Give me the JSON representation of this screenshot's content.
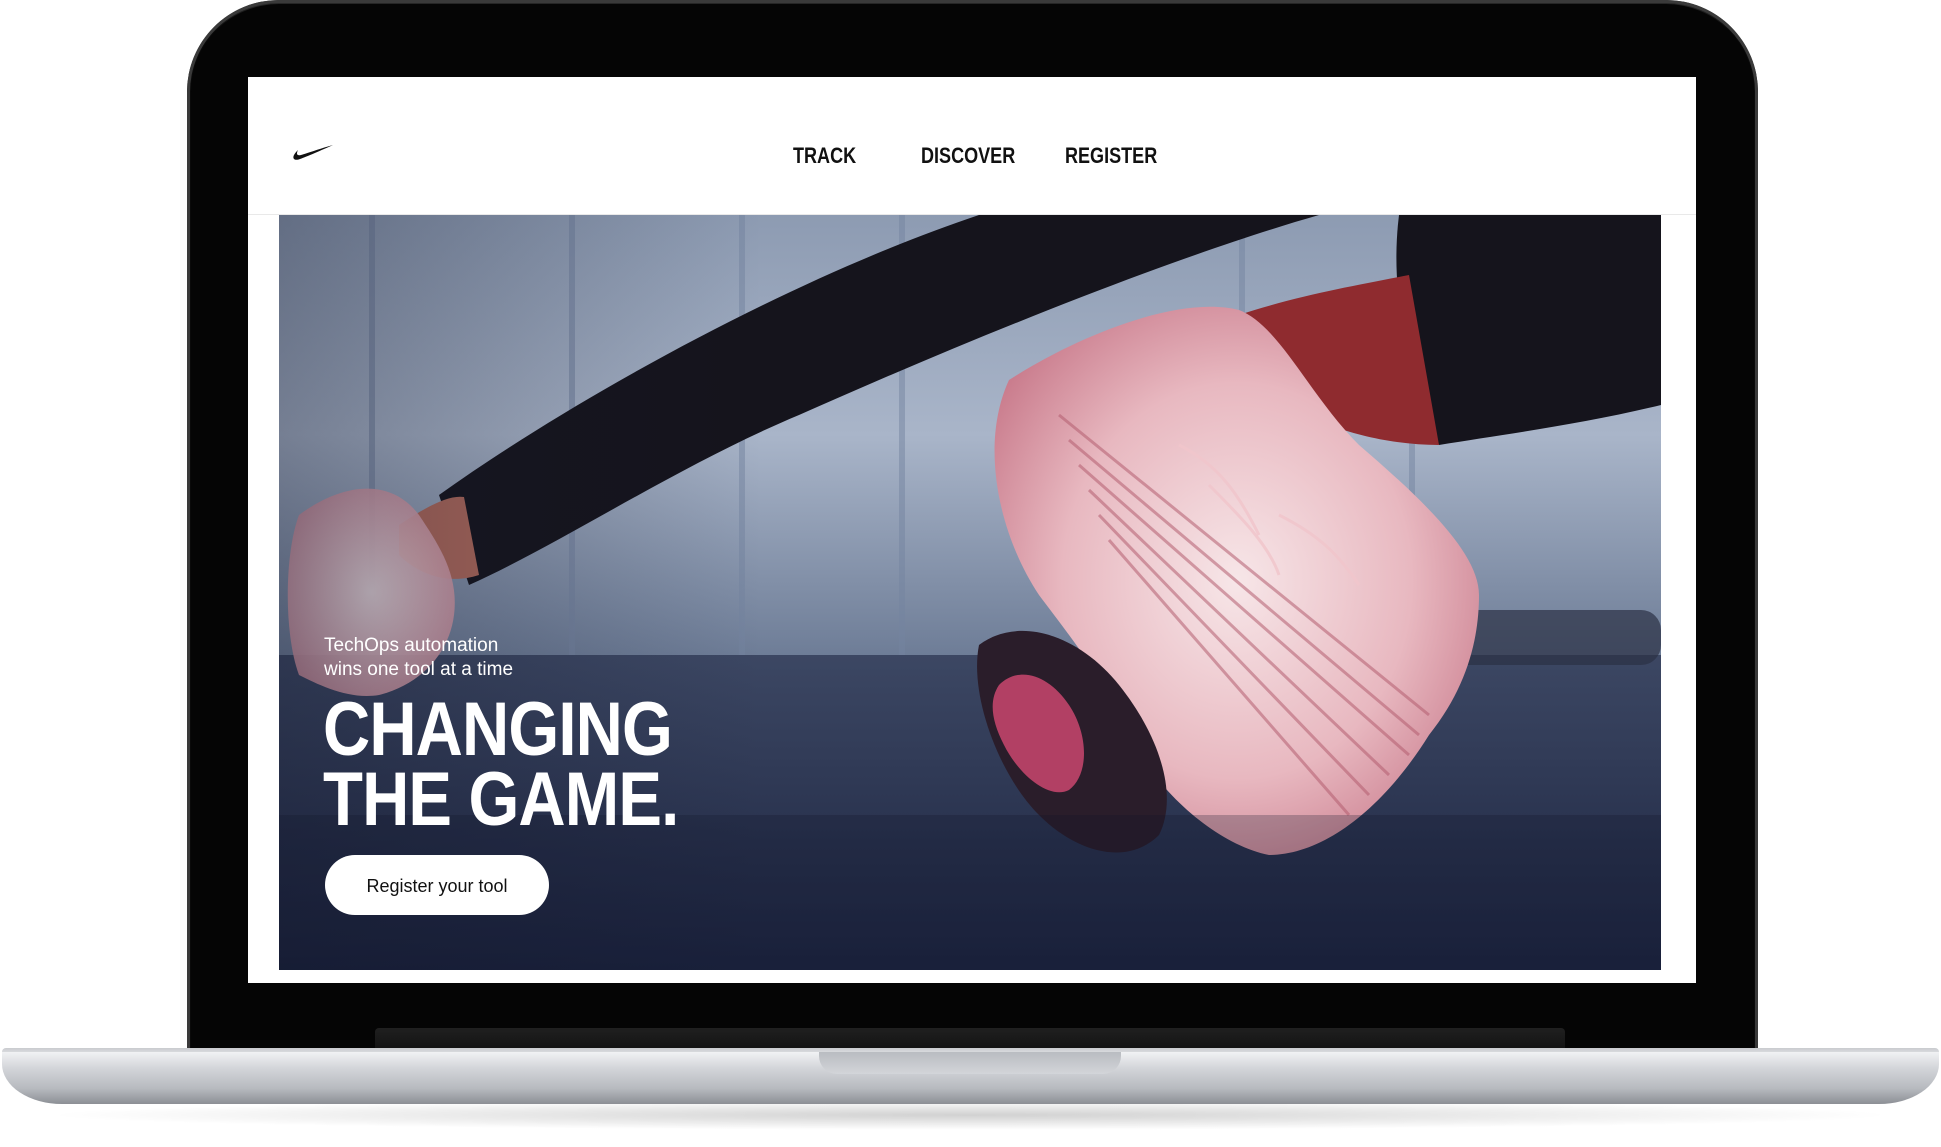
{
  "nav": {
    "brand_logo": "swoosh-logo",
    "items": [
      {
        "label": "TRACK"
      },
      {
        "label": "DISCOVER"
      },
      {
        "label": "REGISTER"
      }
    ]
  },
  "hero": {
    "subtitle_line1": "TechOps automation",
    "subtitle_line2": "wins one tool at a time",
    "headline_line1": "CHANGING",
    "headline_line2": "THE GAME.",
    "cta_label": "Register your tool",
    "image": "athlete-sneakers-photo"
  },
  "colors": {
    "text_dark": "#111111",
    "hero_text": "#ffffff",
    "cta_bg": "#ffffff"
  }
}
